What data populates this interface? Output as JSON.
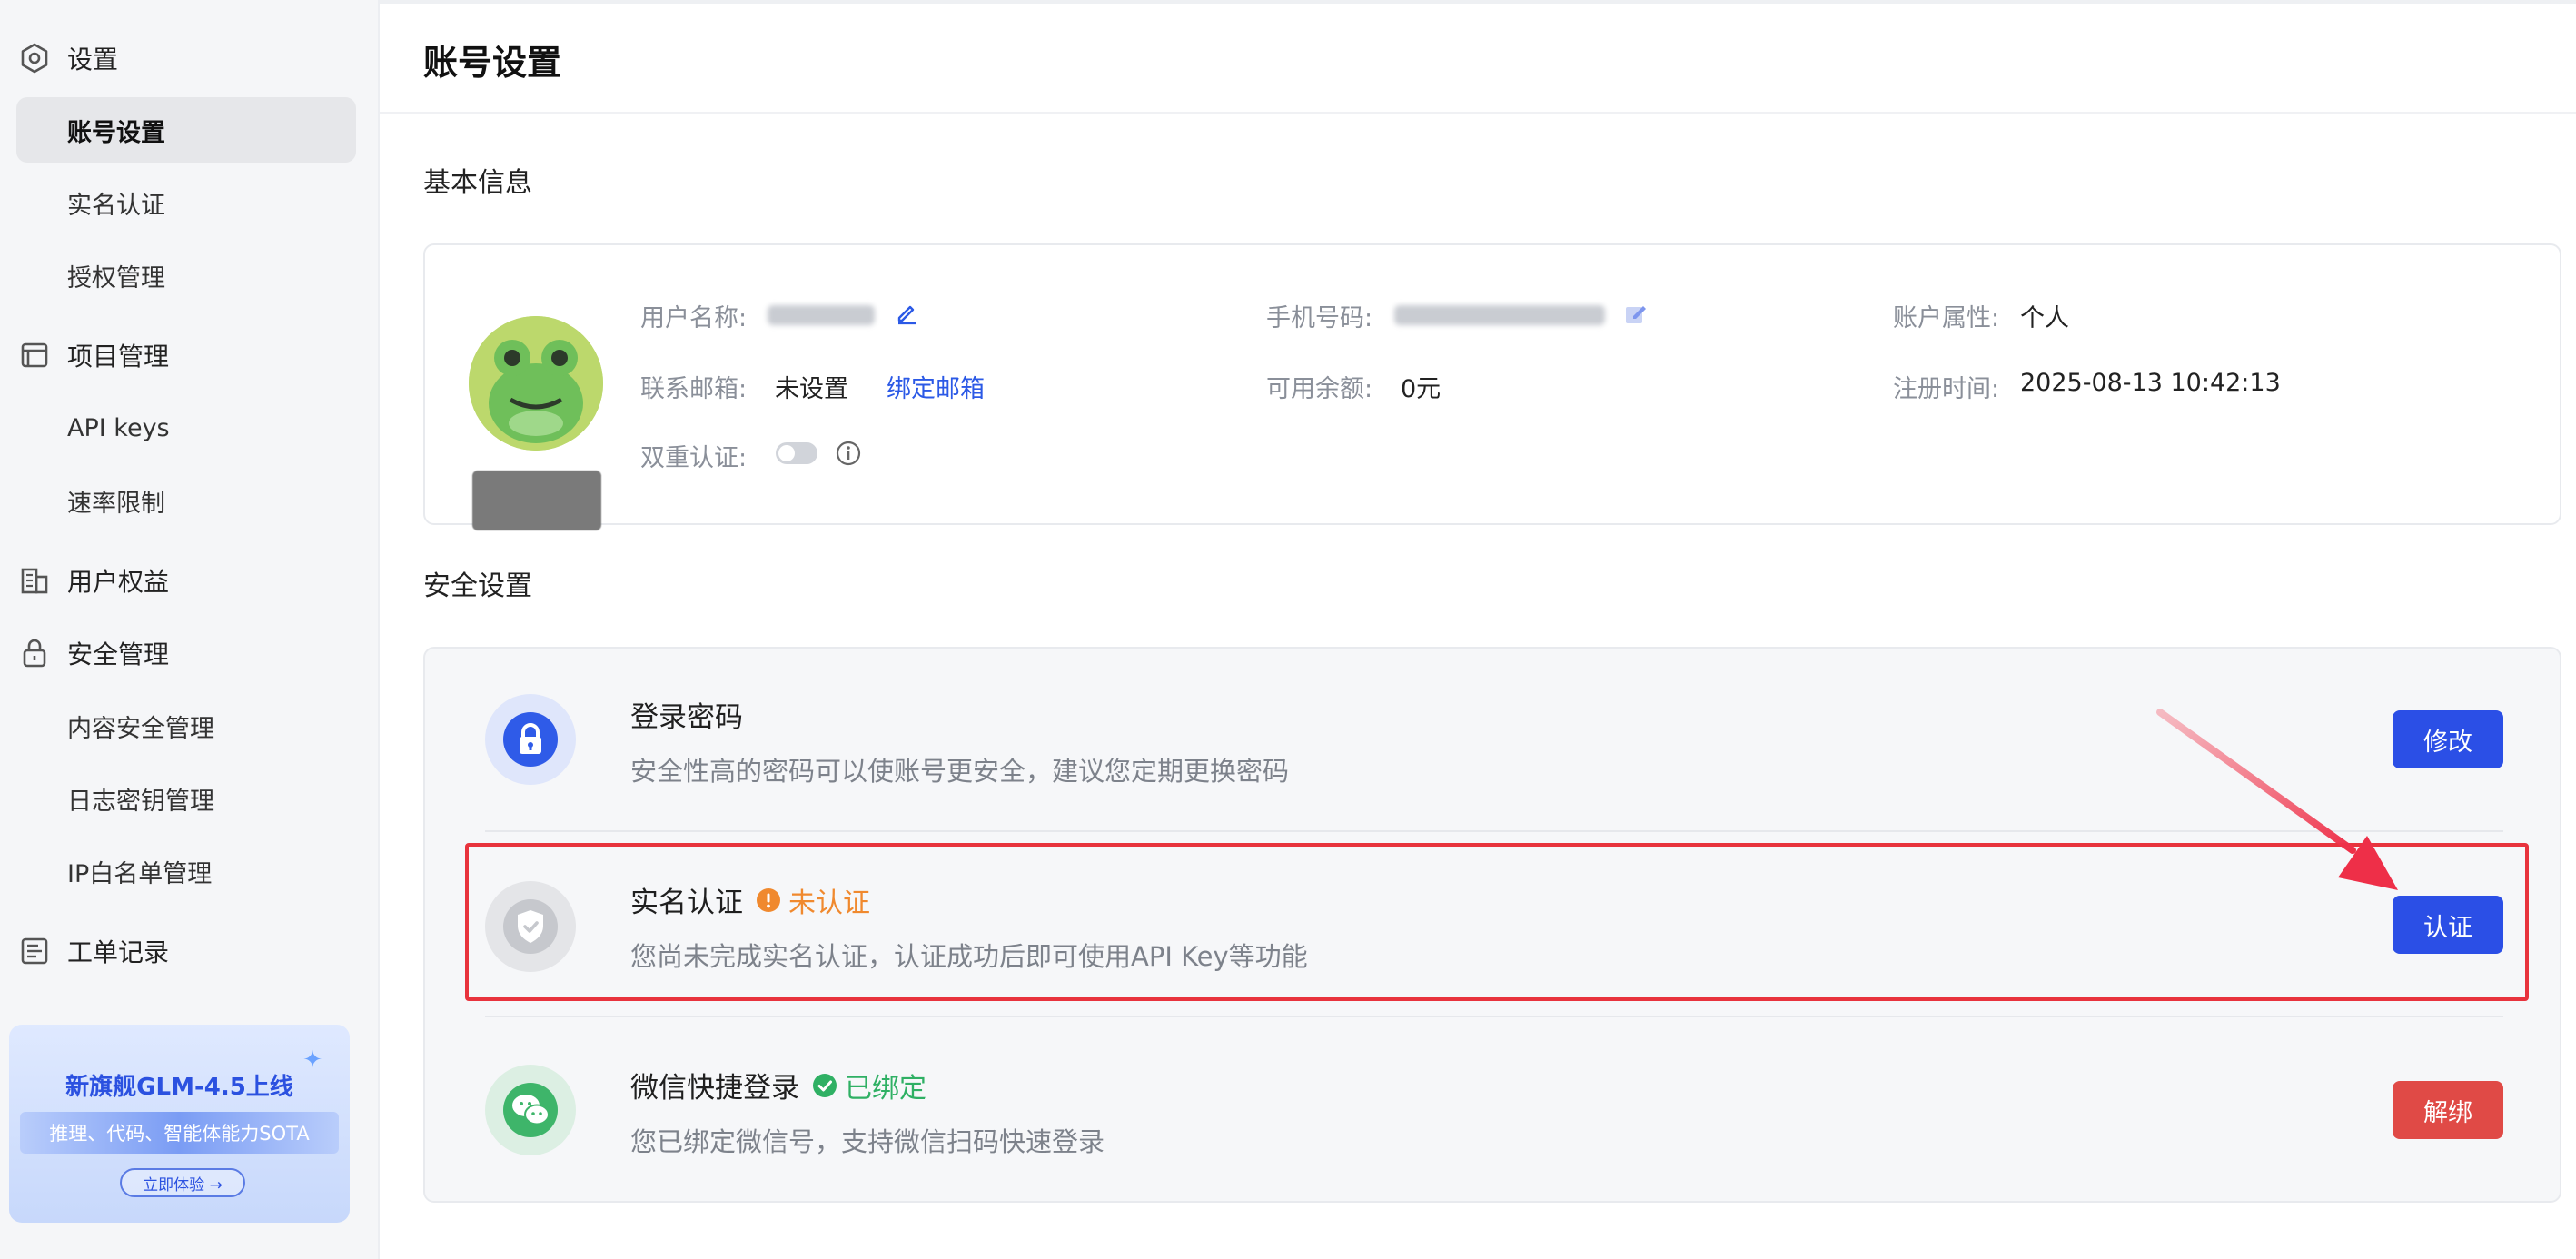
{
  "sidebar": {
    "groups": [
      {
        "label": "设置",
        "icon": "settings-hexagon-icon"
      },
      {
        "label": "项目管理",
        "icon": "window-icon"
      },
      {
        "label": "用户权益",
        "icon": "building-icon"
      },
      {
        "label": "安全管理",
        "icon": "lock-icon"
      },
      {
        "label": "工单记录",
        "icon": "ticket-list-icon"
      }
    ],
    "items": {
      "account_settings": "账号设置",
      "real_name": "实名认证",
      "authorization": "授权管理",
      "api_keys": "API keys",
      "rate_limit": "速率限制",
      "content_security": "内容安全管理",
      "log_key": "日志密钥管理",
      "ip_whitelist": "IP白名单管理"
    },
    "promo": {
      "title": "新旗舰GLM-4.5上线",
      "subtitle": "推理、代码、智能体能力SOTA",
      "button": "立即体验 →"
    }
  },
  "main": {
    "page_title": "账号设置",
    "basic_info": {
      "section_title": "基本信息",
      "username_label": "用户名称:",
      "email_label": "联系邮箱:",
      "email_value": "未设置",
      "bind_email_link": "绑定邮箱",
      "two_factor_label": "双重认证:",
      "two_factor_enabled": false,
      "phone_label": "手机号码:",
      "balance_label": "可用余额:",
      "balance_value": "0元",
      "account_type_label": "账户属性:",
      "account_type_value": "个人",
      "register_time_label": "注册时间:",
      "register_time_value": "2025-08-13 10:42:13"
    },
    "security": {
      "section_title": "安全设置",
      "rows": [
        {
          "title": "登录密码",
          "desc": "安全性高的密码可以使账号更安全，建议您定期更换密码",
          "button": "修改",
          "icon": "padlock-icon"
        },
        {
          "title": "实名认证",
          "status": "未认证",
          "desc": "您尚未完成实名认证，认证成功后即可使用API Key等功能",
          "button": "认证",
          "icon": "shield-check-icon"
        },
        {
          "title": "微信快捷登录",
          "status": "已绑定",
          "desc": "您已绑定微信号，支持微信扫码快速登录",
          "button": "解绑",
          "icon": "wechat-icon"
        }
      ]
    }
  },
  "colors": {
    "primary": "#2b4fe6",
    "danger": "#e04a46",
    "warning": "#f0892e",
    "success": "#2fb064",
    "annotation": "#e8333d"
  }
}
